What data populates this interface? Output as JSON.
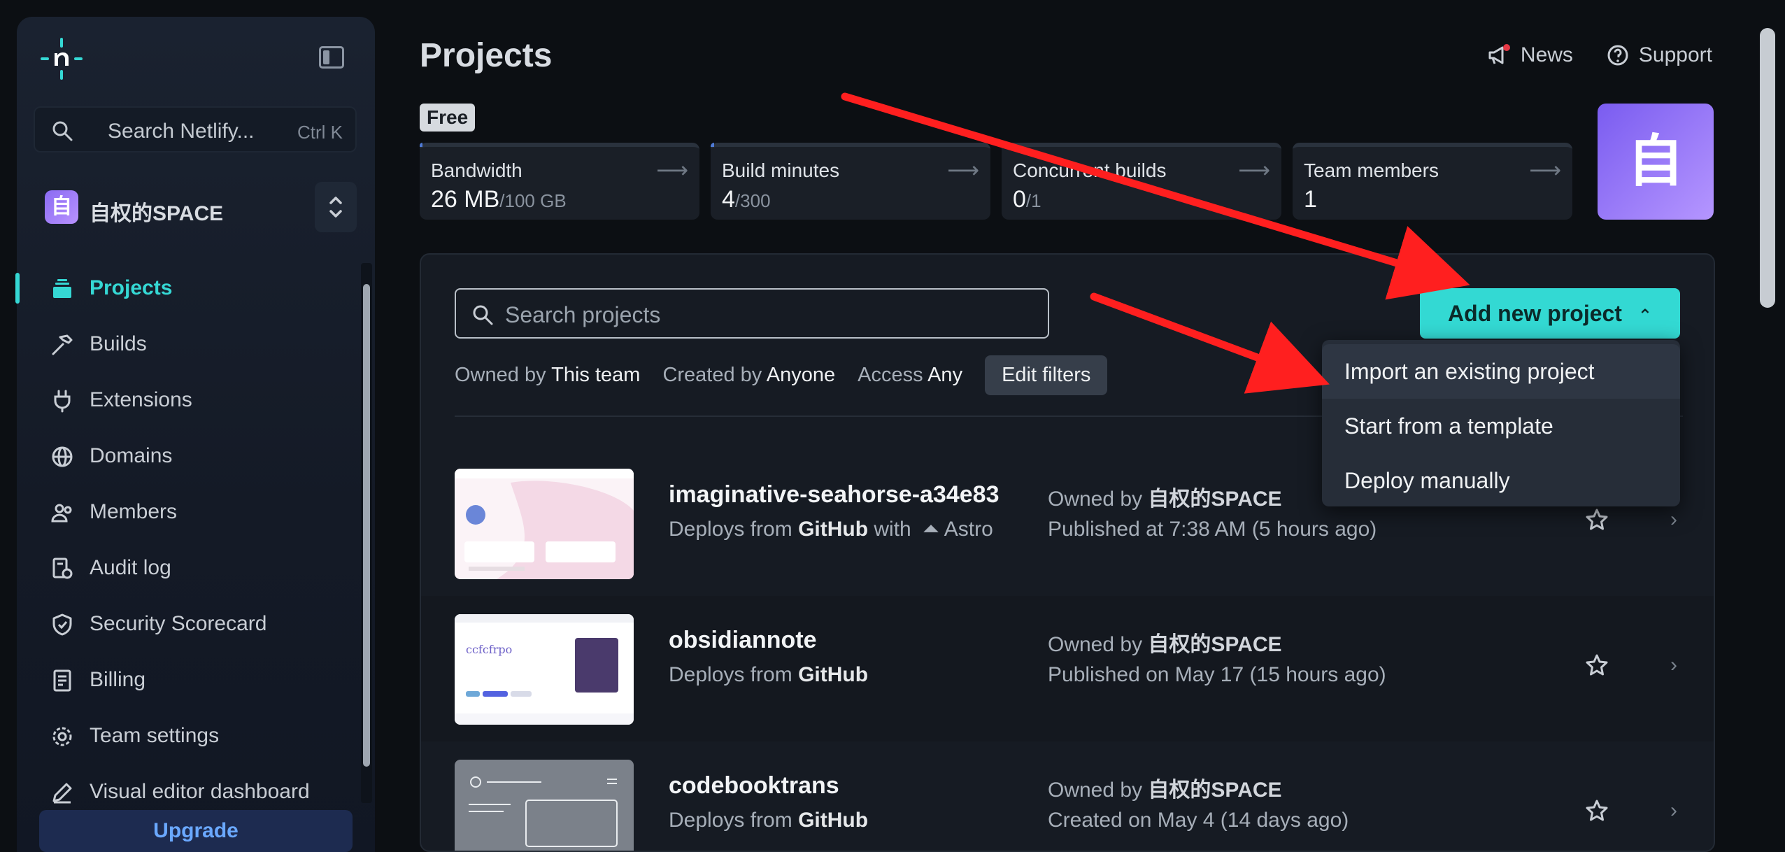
{
  "sidebar": {
    "search_placeholder": "Search Netlify...",
    "search_shortcut": "Ctrl K",
    "team_avatar": "自",
    "team_name": "自权的SPACE",
    "items": [
      {
        "label": "Projects",
        "icon": "layers-icon",
        "active": true
      },
      {
        "label": "Builds",
        "icon": "hammer-icon"
      },
      {
        "label": "Extensions",
        "icon": "plug-icon"
      },
      {
        "label": "Domains",
        "icon": "globe-icon"
      },
      {
        "label": "Members",
        "icon": "members-icon"
      },
      {
        "label": "Audit log",
        "icon": "audit-log-icon"
      },
      {
        "label": "Security Scorecard",
        "icon": "shield-icon"
      },
      {
        "label": "Billing",
        "icon": "receipt-icon"
      },
      {
        "label": "Team settings",
        "icon": "gear-icon"
      },
      {
        "label": "Visual editor dashboard",
        "icon": "pencil-icon"
      }
    ],
    "upgrade_label": "Upgrade"
  },
  "header": {
    "title": "Projects",
    "news_label": "News",
    "support_label": "Support",
    "tier": "Free",
    "team_tile": "自"
  },
  "stats": [
    {
      "label": "Bandwidth",
      "value": "26 MB",
      "limit": "/100 GB",
      "usage": 0.0003
    },
    {
      "label": "Build minutes",
      "value": "4",
      "limit": "/300",
      "usage": 0.013
    },
    {
      "label": "Concurrent builds",
      "value": "0",
      "limit": "/1",
      "usage": 0
    },
    {
      "label": "Team members",
      "value": "1",
      "limit": "",
      "usage": 0
    }
  ],
  "projects_panel": {
    "search_placeholder": "Search projects",
    "add_button": "Add new project",
    "filters": {
      "owned_label": "Owned by",
      "owned_value": "This team",
      "created_label": "Created by",
      "created_value": "Anyone",
      "access_label": "Access",
      "access_value": "Any",
      "edit_label": "Edit filters"
    },
    "dropdown": [
      "Import an existing project",
      "Start from a template",
      "Deploy manually"
    ],
    "rows": [
      {
        "name": "imaginative-seahorse-a34e83",
        "deploy_prefix": "Deploys from",
        "deploy_source": "GitHub",
        "deploy_with": "with",
        "framework": "Astro",
        "owner_prefix": "Owned by",
        "owner": "自权的SPACE",
        "status": "Published at 7:38 AM (5 hours ago)"
      },
      {
        "name": "obsidiannote",
        "deploy_prefix": "Deploys from",
        "deploy_source": "GitHub",
        "owner_prefix": "Owned by",
        "owner": "自权的SPACE",
        "status": "Published on May 17 (15 hours ago)"
      },
      {
        "name": "codebooktrans",
        "deploy_prefix": "Deploys from",
        "deploy_source": "GitHub",
        "owner_prefix": "Owned by",
        "owner": "自权的SPACE",
        "status": "Created on May 4 (14 days ago)"
      }
    ]
  },
  "colors": {
    "accent": "#33d9d3",
    "annotation_arrow": "#ff1f1f",
    "team_avatar": "#8a6bf2"
  }
}
